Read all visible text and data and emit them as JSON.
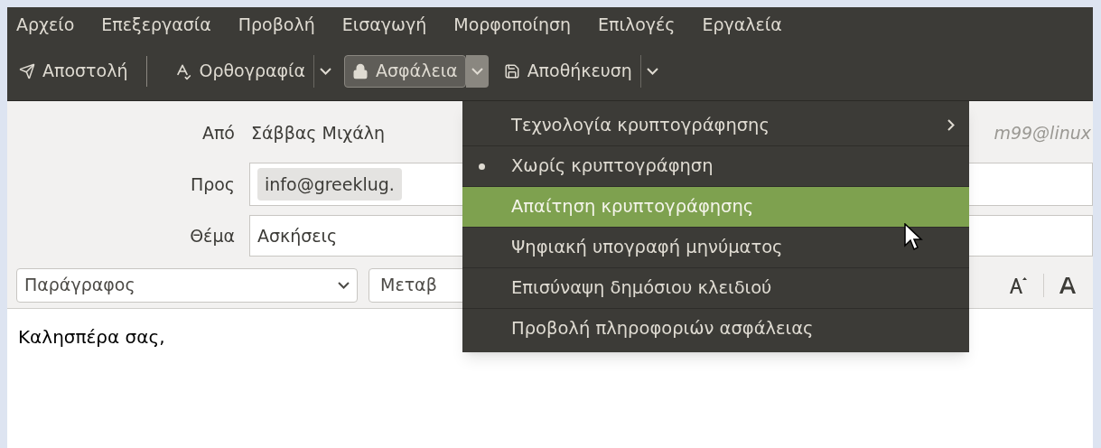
{
  "menubar": [
    {
      "label": "Αρχείο"
    },
    {
      "label": "Επεξεργασία"
    },
    {
      "label": "Προβολή"
    },
    {
      "label": "Εισαγωγή"
    },
    {
      "label": "Μορφοποίηση"
    },
    {
      "label": "Επιλογές"
    },
    {
      "label": "Εργαλεία"
    }
  ],
  "toolbar": [
    {
      "kind": "send",
      "label": "Αποστολή",
      "selected": false
    },
    {
      "kind": "spelling",
      "label": "Ορθογραφία",
      "selected": false
    },
    {
      "kind": "security",
      "label": "Ασφάλεια",
      "selected": true
    },
    {
      "kind": "save",
      "label": "Αποθήκευση",
      "selected": false
    }
  ],
  "header": {
    "from": {
      "label": "Από",
      "name": "Σάββας Μιχάλη",
      "address": "m99@linux"
    },
    "to": {
      "label": "Προς",
      "recipient": "info@greeklug."
    },
    "subject": {
      "label": "Θέμα",
      "value": "Ασκήσεις"
    }
  },
  "format_bar": {
    "paragraph": "Παράγραφος",
    "font": "Μεταβ"
  },
  "body": "Καλησπέρα σας,",
  "security_menu": [
    {
      "label": "Τεχνολογία κρυπτογράφησης",
      "submenu": true,
      "selected": false,
      "highlighted": false
    },
    {
      "label": "Χωρίς κρυπτογράφηση",
      "submenu": false,
      "selected": true,
      "highlighted": false
    },
    {
      "label": "Απαίτηση κρυπτογράφησης",
      "submenu": false,
      "selected": false,
      "highlighted": true
    },
    {
      "label": "Ψηφιακή υπογραφή μηνύματος",
      "submenu": false,
      "selected": false,
      "highlighted": false
    },
    {
      "label": "Επισύναψη δημόσιου κλειδιού",
      "submenu": false,
      "selected": false,
      "highlighted": false
    },
    {
      "label": "Προβολή πληροφοριών ασφάλειας",
      "submenu": false,
      "selected": false,
      "highlighted": false
    }
  ]
}
